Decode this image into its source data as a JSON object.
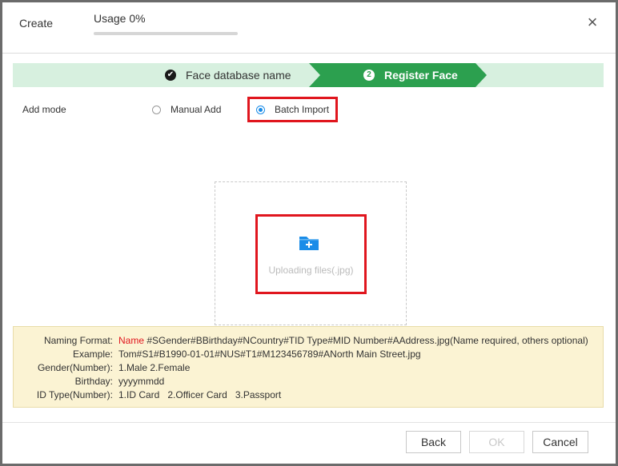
{
  "header": {
    "title": "Create",
    "usage_label": "Usage 0%",
    "usage_percent": 0,
    "close_glyph": "×"
  },
  "steps": [
    {
      "label": "Face database name",
      "status": "done",
      "icon": "check-icon"
    },
    {
      "label": "Register Face",
      "status": "active",
      "number": "2"
    }
  ],
  "add_mode": {
    "label": "Add mode",
    "options": [
      {
        "label": "Manual Add",
        "selected": false
      },
      {
        "label": "Batch Import",
        "selected": true
      }
    ]
  },
  "upload": {
    "text": "Uploading files(.jpg)",
    "icon": "folder-add-icon"
  },
  "info": {
    "rows": [
      {
        "key": "Naming Format:",
        "highlight": "Name",
        "value": " #SGender#BBirthday#NCountry#TID Type#MID Number#AAddress.jpg(Name required, others optional)"
      },
      {
        "key": "Example:",
        "highlight": "",
        "value": "Tom#S1#B1990-01-01#NUS#T1#M123456789#ANorth Main Street.jpg"
      },
      {
        "key": "Gender(Number):",
        "highlight": "",
        "value": "1.Male 2.Female"
      },
      {
        "key": "Birthday:",
        "highlight": "",
        "value": "yyyymmdd"
      },
      {
        "key": "ID Type(Number):",
        "highlight": "",
        "value": "1.ID Card   2.Officer Card   3.Passport"
      }
    ]
  },
  "footer": {
    "back_label": "Back",
    "ok_label": "OK",
    "cancel_label": "Cancel"
  },
  "colors": {
    "step_done_bg": "#d7f0df",
    "step_active_bg": "#2ca04f",
    "highlight_red": "#e0161e",
    "radio_blue": "#1a8ce8",
    "info_bg": "#fbf3d3"
  }
}
